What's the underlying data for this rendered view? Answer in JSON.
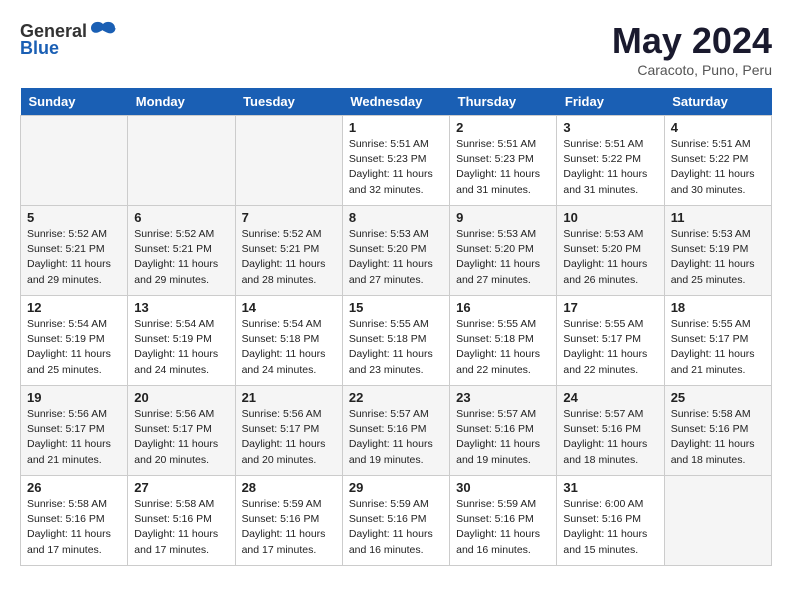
{
  "header": {
    "logo_general": "General",
    "logo_blue": "Blue",
    "title": "May 2024",
    "location": "Caracoto, Puno, Peru"
  },
  "days_of_week": [
    "Sunday",
    "Monday",
    "Tuesday",
    "Wednesday",
    "Thursday",
    "Friday",
    "Saturday"
  ],
  "weeks": [
    [
      {
        "day": "",
        "info": ""
      },
      {
        "day": "",
        "info": ""
      },
      {
        "day": "",
        "info": ""
      },
      {
        "day": "1",
        "info": "Sunrise: 5:51 AM\nSunset: 5:23 PM\nDaylight: 11 hours\nand 32 minutes."
      },
      {
        "day": "2",
        "info": "Sunrise: 5:51 AM\nSunset: 5:23 PM\nDaylight: 11 hours\nand 31 minutes."
      },
      {
        "day": "3",
        "info": "Sunrise: 5:51 AM\nSunset: 5:22 PM\nDaylight: 11 hours\nand 31 minutes."
      },
      {
        "day": "4",
        "info": "Sunrise: 5:51 AM\nSunset: 5:22 PM\nDaylight: 11 hours\nand 30 minutes."
      }
    ],
    [
      {
        "day": "5",
        "info": "Sunrise: 5:52 AM\nSunset: 5:21 PM\nDaylight: 11 hours\nand 29 minutes."
      },
      {
        "day": "6",
        "info": "Sunrise: 5:52 AM\nSunset: 5:21 PM\nDaylight: 11 hours\nand 29 minutes."
      },
      {
        "day": "7",
        "info": "Sunrise: 5:52 AM\nSunset: 5:21 PM\nDaylight: 11 hours\nand 28 minutes."
      },
      {
        "day": "8",
        "info": "Sunrise: 5:53 AM\nSunset: 5:20 PM\nDaylight: 11 hours\nand 27 minutes."
      },
      {
        "day": "9",
        "info": "Sunrise: 5:53 AM\nSunset: 5:20 PM\nDaylight: 11 hours\nand 27 minutes."
      },
      {
        "day": "10",
        "info": "Sunrise: 5:53 AM\nSunset: 5:20 PM\nDaylight: 11 hours\nand 26 minutes."
      },
      {
        "day": "11",
        "info": "Sunrise: 5:53 AM\nSunset: 5:19 PM\nDaylight: 11 hours\nand 25 minutes."
      }
    ],
    [
      {
        "day": "12",
        "info": "Sunrise: 5:54 AM\nSunset: 5:19 PM\nDaylight: 11 hours\nand 25 minutes."
      },
      {
        "day": "13",
        "info": "Sunrise: 5:54 AM\nSunset: 5:19 PM\nDaylight: 11 hours\nand 24 minutes."
      },
      {
        "day": "14",
        "info": "Sunrise: 5:54 AM\nSunset: 5:18 PM\nDaylight: 11 hours\nand 24 minutes."
      },
      {
        "day": "15",
        "info": "Sunrise: 5:55 AM\nSunset: 5:18 PM\nDaylight: 11 hours\nand 23 minutes."
      },
      {
        "day": "16",
        "info": "Sunrise: 5:55 AM\nSunset: 5:18 PM\nDaylight: 11 hours\nand 22 minutes."
      },
      {
        "day": "17",
        "info": "Sunrise: 5:55 AM\nSunset: 5:17 PM\nDaylight: 11 hours\nand 22 minutes."
      },
      {
        "day": "18",
        "info": "Sunrise: 5:55 AM\nSunset: 5:17 PM\nDaylight: 11 hours\nand 21 minutes."
      }
    ],
    [
      {
        "day": "19",
        "info": "Sunrise: 5:56 AM\nSunset: 5:17 PM\nDaylight: 11 hours\nand 21 minutes."
      },
      {
        "day": "20",
        "info": "Sunrise: 5:56 AM\nSunset: 5:17 PM\nDaylight: 11 hours\nand 20 minutes."
      },
      {
        "day": "21",
        "info": "Sunrise: 5:56 AM\nSunset: 5:17 PM\nDaylight: 11 hours\nand 20 minutes."
      },
      {
        "day": "22",
        "info": "Sunrise: 5:57 AM\nSunset: 5:16 PM\nDaylight: 11 hours\nand 19 minutes."
      },
      {
        "day": "23",
        "info": "Sunrise: 5:57 AM\nSunset: 5:16 PM\nDaylight: 11 hours\nand 19 minutes."
      },
      {
        "day": "24",
        "info": "Sunrise: 5:57 AM\nSunset: 5:16 PM\nDaylight: 11 hours\nand 18 minutes."
      },
      {
        "day": "25",
        "info": "Sunrise: 5:58 AM\nSunset: 5:16 PM\nDaylight: 11 hours\nand 18 minutes."
      }
    ],
    [
      {
        "day": "26",
        "info": "Sunrise: 5:58 AM\nSunset: 5:16 PM\nDaylight: 11 hours\nand 17 minutes."
      },
      {
        "day": "27",
        "info": "Sunrise: 5:58 AM\nSunset: 5:16 PM\nDaylight: 11 hours\nand 17 minutes."
      },
      {
        "day": "28",
        "info": "Sunrise: 5:59 AM\nSunset: 5:16 PM\nDaylight: 11 hours\nand 17 minutes."
      },
      {
        "day": "29",
        "info": "Sunrise: 5:59 AM\nSunset: 5:16 PM\nDaylight: 11 hours\nand 16 minutes."
      },
      {
        "day": "30",
        "info": "Sunrise: 5:59 AM\nSunset: 5:16 PM\nDaylight: 11 hours\nand 16 minutes."
      },
      {
        "day": "31",
        "info": "Sunrise: 6:00 AM\nSunset: 5:16 PM\nDaylight: 11 hours\nand 15 minutes."
      },
      {
        "day": "",
        "info": ""
      }
    ]
  ]
}
